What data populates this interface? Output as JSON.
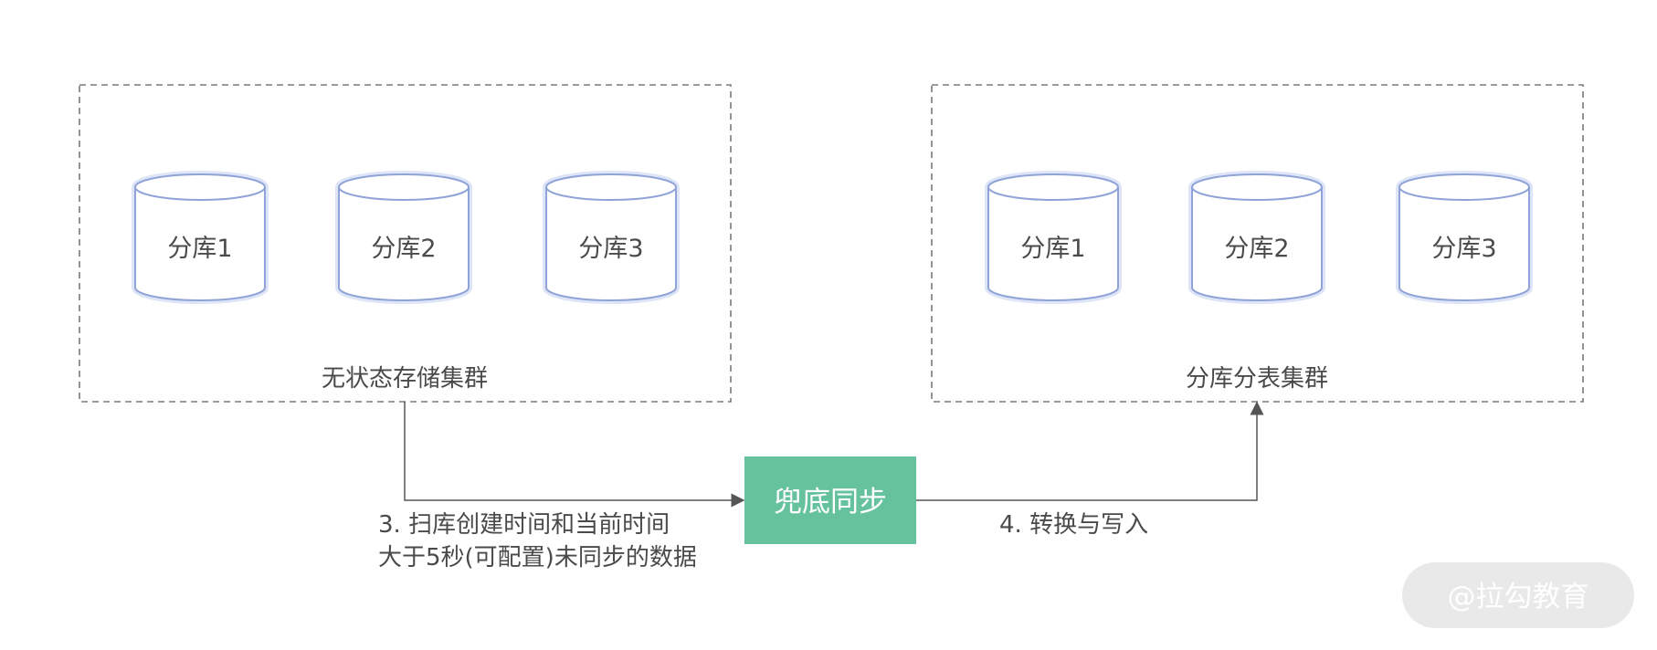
{
  "clusters": [
    {
      "label": "无状态存储集群",
      "databases": [
        "分库1",
        "分库2",
        "分库3"
      ]
    },
    {
      "label": "分库分表集群",
      "databases": [
        "分库1",
        "分库2",
        "分库3"
      ]
    }
  ],
  "process": {
    "label": "兜底同步"
  },
  "edges": {
    "scan": {
      "line1": "3. 扫库创建时间和当前时间",
      "line2": "大于5秒(可配置)未同步的数据"
    },
    "transform": {
      "label": "4. 转换与写入"
    }
  },
  "colors": {
    "process_fill": "#66c19d",
    "db_stroke": "#8fa3d8",
    "cluster_stroke": "#7a7a7a"
  },
  "watermark": {
    "text": "@拉勾教育"
  }
}
